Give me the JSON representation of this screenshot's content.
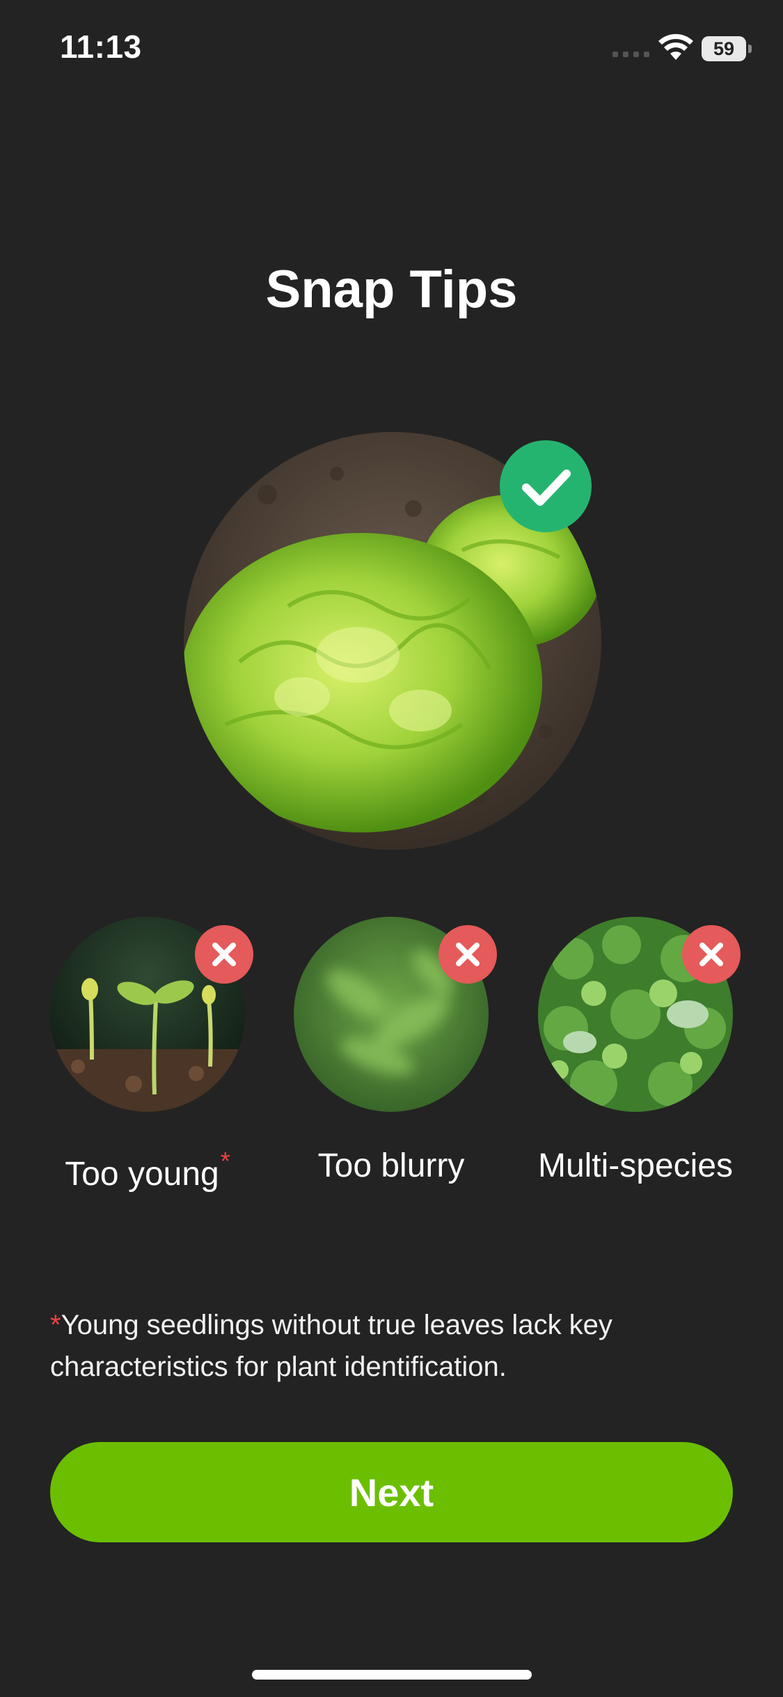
{
  "status_bar": {
    "time": "11:13",
    "battery": "59",
    "icons": [
      "signal-icon",
      "wifi-icon",
      "battery-icon"
    ]
  },
  "title": "Snap Tips",
  "main_example": {
    "icon": "check-icon",
    "status_color": "#25b46f"
  },
  "bad_examples": [
    {
      "label": "Too young",
      "icon": "x-icon",
      "has_asterisk": true
    },
    {
      "label": "Too blurry",
      "icon": "x-icon"
    },
    {
      "label": "Multi-species",
      "icon": "x-icon"
    }
  ],
  "footnote": {
    "asterisk": "*",
    "text": "Young seedlings without true leaves lack key characteristics for plant identification."
  },
  "next_button": {
    "label": "Next"
  },
  "colors": {
    "background": "#232323",
    "accent": "#6bbf00",
    "success": "#25b46f",
    "error": "#e55a5a"
  }
}
